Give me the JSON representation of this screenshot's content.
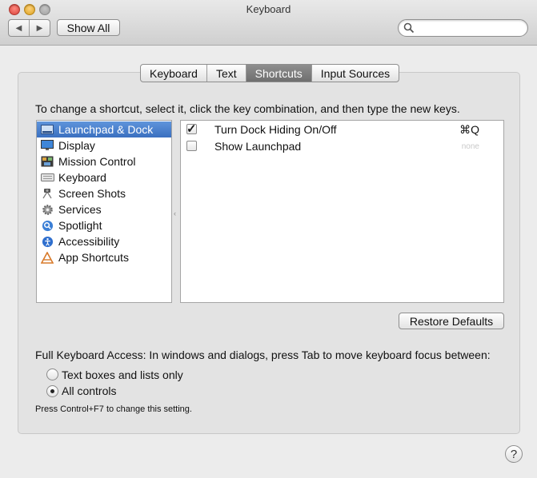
{
  "window": {
    "title": "Keyboard"
  },
  "toolbar": {
    "back_glyph": "◀",
    "forward_glyph": "▶",
    "show_all_label": "Show All",
    "search_value": "",
    "search_placeholder": ""
  },
  "tabs": [
    {
      "label": "Keyboard",
      "selected": false
    },
    {
      "label": "Text",
      "selected": false
    },
    {
      "label": "Shortcuts",
      "selected": true
    },
    {
      "label": "Input Sources",
      "selected": false
    }
  ],
  "instructions": "To change a shortcut, select it, click the key combination, and then type the new keys.",
  "categories": [
    {
      "label": "Launchpad & Dock",
      "icon": "dock-icon",
      "selected": true
    },
    {
      "label": "Display",
      "icon": "display-icon",
      "selected": false
    },
    {
      "label": "Mission Control",
      "icon": "mission-control-icon",
      "selected": false
    },
    {
      "label": "Keyboard",
      "icon": "keyboard-icon",
      "selected": false
    },
    {
      "label": "Screen Shots",
      "icon": "camera-icon",
      "selected": false
    },
    {
      "label": "Services",
      "icon": "gear-icon",
      "selected": false
    },
    {
      "label": "Spotlight",
      "icon": "spotlight-icon",
      "selected": false
    },
    {
      "label": "Accessibility",
      "icon": "accessibility-icon",
      "selected": false
    },
    {
      "label": "App Shortcuts",
      "icon": "app-shortcuts-icon",
      "selected": false
    }
  ],
  "shortcuts": [
    {
      "label": "Turn Dock Hiding On/Off",
      "checked": true,
      "shortcut": "⌘Q"
    },
    {
      "label": "Show Launchpad",
      "checked": false,
      "shortcut": "none"
    }
  ],
  "restore_defaults_label": "Restore Defaults",
  "full_keyboard_access": {
    "text": "Full Keyboard Access: In windows and dialogs, press Tab to move keyboard focus between:",
    "options": [
      {
        "label": "Text boxes and lists only",
        "selected": false
      },
      {
        "label": "All controls",
        "selected": true
      }
    ],
    "note": "Press Control+F7 to change this setting."
  },
  "help_glyph": "?",
  "colors": {
    "selection": "#3a6fc0",
    "selected_tab": "#7a7a7a"
  }
}
